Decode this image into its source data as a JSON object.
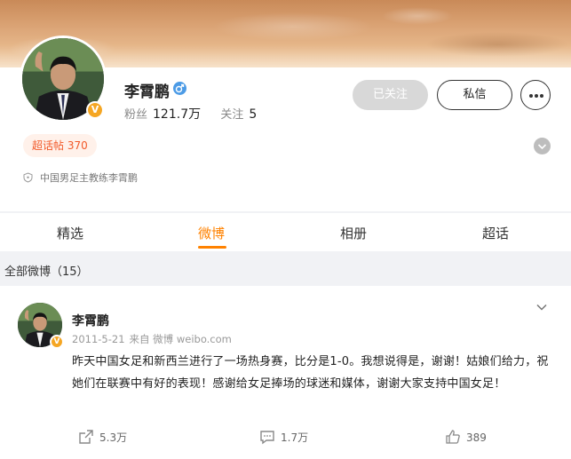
{
  "profile": {
    "name": "李霄鹏",
    "followers_label": "粉丝",
    "followers_value": "121.7万",
    "following_label": "关注",
    "following_value": "5",
    "follow_button": "已关注",
    "message_button": "私信",
    "supertopic_badge": "超话帖 370",
    "bio": "中国男足主教练李霄鹏",
    "verified_badge": "V",
    "accent_color": "#ff8200"
  },
  "tabs": [
    {
      "label": "精选"
    },
    {
      "label": "微博"
    },
    {
      "label": "相册"
    },
    {
      "label": "超话"
    }
  ],
  "section": {
    "title": "全部微博（15）"
  },
  "post": {
    "author": "李霄鹏",
    "date": "2011-5-21",
    "source": "来自 微博 weibo.com",
    "text": "昨天中国女足和新西兰进行了一场热身赛，比分是1-0。我想说得是，谢谢！姑娘们给力，祝她们在联赛中有好的表现！感谢给女足捧场的球迷和媒体，谢谢大家支持中国女足！",
    "reposts": "5.3万",
    "comments": "1.7万",
    "likes": "389"
  },
  "icons": {
    "male": "male-icon",
    "shield": "shield-icon",
    "repost": "repost-icon",
    "comment": "comment-icon",
    "like": "like-icon",
    "more": "more-icon",
    "chevron": "chevron-down-icon"
  }
}
